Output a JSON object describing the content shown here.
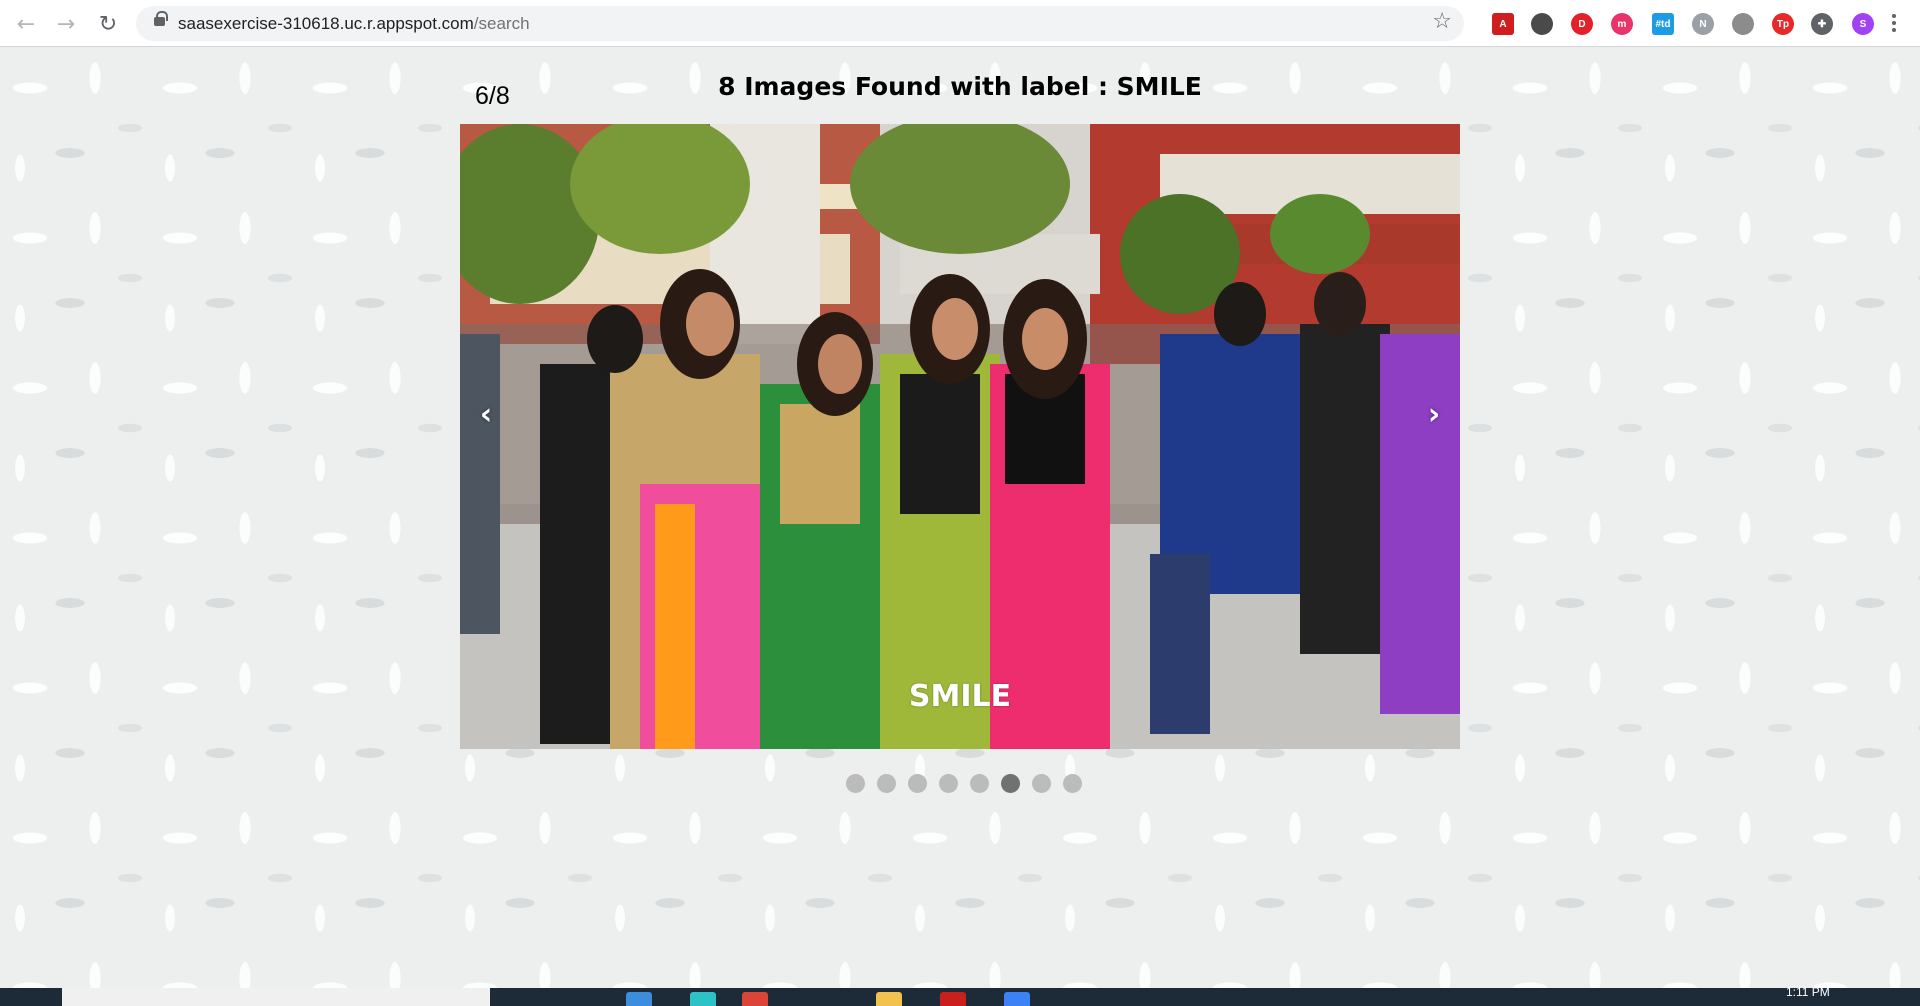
{
  "browser": {
    "url_host": "saasexercise-310618.uc.r.appspot.com",
    "url_path": "/search",
    "extensions": [
      {
        "name": "acrobat-icon",
        "color": "#d01e1e",
        "label": "A"
      },
      {
        "name": "circle-extension-icon",
        "color": "#4a4a4a",
        "label": ""
      },
      {
        "name": "d-extension-icon",
        "color": "#e22129",
        "label": "D"
      },
      {
        "name": "m-extension-icon",
        "color": "#e8336b",
        "label": "m"
      },
      {
        "name": "td-extension-icon",
        "color": "#1d9be5",
        "label": "#td"
      },
      {
        "name": "nj-extension-icon",
        "color": "#9aa0a6",
        "label": "N"
      },
      {
        "name": "face-extension-icon",
        "color": "#8c8c8c",
        "label": ""
      },
      {
        "name": "tp-extension-icon",
        "color": "#e62a2a",
        "label": "Tp"
      },
      {
        "name": "puzzle-icon",
        "color": "#5f6368",
        "label": "✚"
      },
      {
        "name": "profile-avatar",
        "color": "#a142f4",
        "label": "S"
      }
    ]
  },
  "gallery": {
    "counter": "6/8",
    "heading": "8 Images Found with label : SMILE",
    "caption": "SMILE",
    "total": 8,
    "active_index": 6,
    "prev_glyph": "‹",
    "next_glyph": "›"
  },
  "taskbar": {
    "time": "1:11 PM"
  }
}
